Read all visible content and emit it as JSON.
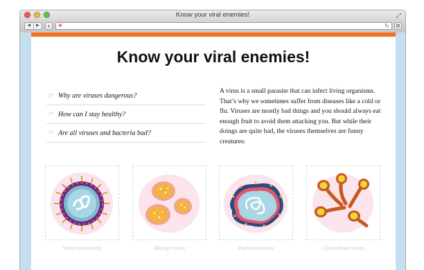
{
  "window": {
    "title": "Know your viral enemies!",
    "controls": {
      "close_color": "#ee5b52",
      "minimize_color": "#f3b941",
      "zoom_color": "#5fc44e"
    }
  },
  "toolbar": {
    "back_icon": "back-arrow-icon",
    "forward_icon": "forward-arrow-icon",
    "new_tab_label": "+",
    "url": "",
    "reload_icon": "reload-icon"
  },
  "page": {
    "accent_color": "#f36f21",
    "title": "Know your viral enemies!",
    "questions": [
      {
        "icon": "pointing-hand-icon",
        "label": "Why are viruses dangerous?"
      },
      {
        "icon": "pointing-hand-icon",
        "label": "How can I stay healthy?"
      },
      {
        "icon": "pointing-hand-icon",
        "label": "Are all viruses and bacteria bad?"
      }
    ],
    "intro": "A virus is a small parasite that can infect living organisms. That’s why we sometimes suffer from diseases like a cold or flu. Viruses are mostly bad things and you should always eat enough fruit to avoid them attacking you. But while their doings are quite bad, the viruses themselves are funny creatures:",
    "gallery": [
      {
        "icon": "virus-structure-illustration",
        "caption": "Virus (structure)"
      },
      {
        "icon": "mumps-virus-illustration",
        "caption": "Mumps virus"
      },
      {
        "icon": "paramyxovirus-illustration",
        "caption": "Paramyxovirus"
      },
      {
        "icon": "clostridium-tetani-illustration",
        "caption": "Clostridium tetani"
      }
    ]
  }
}
